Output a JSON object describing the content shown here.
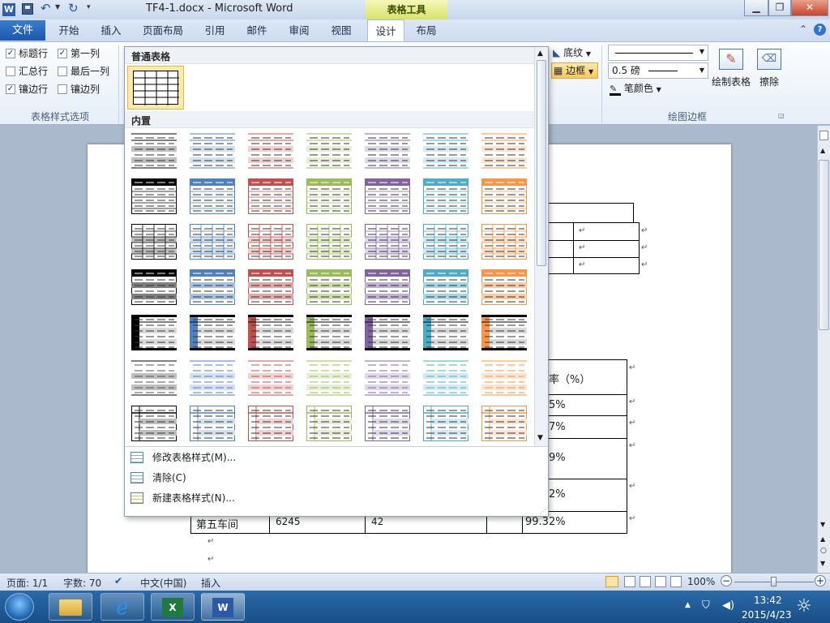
{
  "title_bar": {
    "document_title": "TF4-1.docx  -  Microsoft Word",
    "context_tool_label": "表格工具",
    "app_icon_letter": "W"
  },
  "ribbon_tabs": [
    {
      "label": "文件"
    },
    {
      "label": "开始"
    },
    {
      "label": "插入"
    },
    {
      "label": "页面布局"
    },
    {
      "label": "引用"
    },
    {
      "label": "邮件"
    },
    {
      "label": "审阅"
    },
    {
      "label": "视图"
    },
    {
      "label": "设计"
    },
    {
      "label": "布局"
    }
  ],
  "active_tab": "设计",
  "style_options": {
    "group_label": "表格样式选项",
    "items": [
      {
        "label": "标题行",
        "checked": true
      },
      {
        "label": "第一列",
        "checked": true
      },
      {
        "label": "汇总行",
        "checked": false
      },
      {
        "label": "最后一列",
        "checked": false
      },
      {
        "label": "镶边行",
        "checked": true
      },
      {
        "label": "镶边列",
        "checked": false
      }
    ]
  },
  "shading_label": "底纹",
  "borders_label": "边框",
  "draw_borders": {
    "group_label": "绘图边框",
    "line_weight": "0.5 磅",
    "pen_color_label": "笔颜色",
    "draw_table_label": "绘制表格",
    "eraser_label": "擦除"
  },
  "gallery": {
    "section_plain": "普通表格",
    "section_builtin": "内置",
    "accent_colors": [
      "#000000",
      "#4f81bd",
      "#c0504d",
      "#9bbb59",
      "#8064a2",
      "#4bacc6",
      "#f79646"
    ],
    "style_rows": [
      "light-shading",
      "light-list",
      "light-grid",
      "medium-shading-1",
      "medium-shading-2",
      "medium-list-1",
      "medium-list-2"
    ],
    "menu": [
      {
        "label": "修改表格样式(M)...",
        "icon": "modify-table-style-icon"
      },
      {
        "label": "清除(C)",
        "icon": "clear-table-style-icon"
      },
      {
        "label": "新建表格样式(N)...",
        "icon": "new-table-style-icon"
      }
    ]
  },
  "document": {
    "return_mark": "↵",
    "table2_header_partial": "率（%）",
    "table2_rows_partial": [
      "5%",
      "7%",
      "9%",
      "2%"
    ],
    "last_row": {
      "name": "第五车间",
      "value1": "6245",
      "value2": "42",
      "value3": "",
      "rate": "99.32%"
    }
  },
  "status_bar": {
    "page": "页面: 1/1",
    "words": "字数: 70",
    "language": "中文(中国)",
    "mode": "插入",
    "zoom": "100%"
  },
  "taskbar": {
    "time": "13:42",
    "date": "2015/4/23",
    "apps": [
      "start-orb",
      "file-explorer",
      "internet-explorer",
      "excel",
      "word"
    ]
  }
}
